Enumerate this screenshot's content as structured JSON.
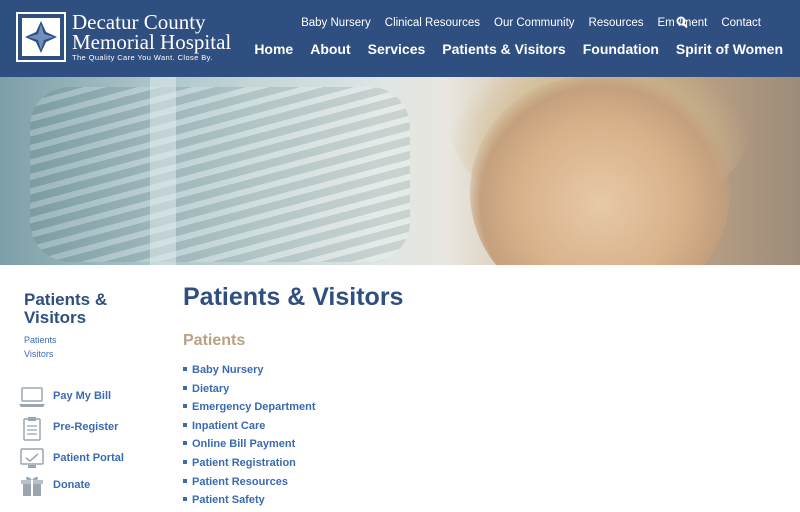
{
  "site": {
    "name_line1": "Decatur County",
    "name_line2": "Memorial Hospital",
    "tagline": "The Quality Care You Want. Close By."
  },
  "utility_nav": [
    "Baby Nursery",
    "Clinical Resources",
    "Our Community",
    "Resources",
    "Em    /ment",
    "Contact"
  ],
  "main_nav": [
    "Home",
    "About",
    "Services",
    "Patients & Visitors",
    "Foundation",
    "Spirit of Women"
  ],
  "sidebar": {
    "title": "Patients & Visitors",
    "links": [
      "Patients",
      "Visitors"
    ],
    "actions": [
      {
        "label": "Pay My Bill",
        "icon": "laptop-icon"
      },
      {
        "label": "Pre-Register",
        "icon": "clipboard-icon"
      },
      {
        "label": "Patient Portal",
        "icon": "monitor-icon"
      },
      {
        "label": "Donate",
        "icon": "gift-icon"
      }
    ]
  },
  "main": {
    "title": "Patients & Visitors",
    "section_title": "Patients",
    "links": [
      "Baby Nursery",
      "Dietary",
      "Emergency Department",
      "Inpatient Care",
      "Online Bill Payment",
      "Patient Registration",
      "Patient Resources",
      "Patient Safety"
    ]
  },
  "colors": {
    "header": "#2f4f80",
    "link": "#3a6bb0",
    "section_title": "#b8a285"
  }
}
